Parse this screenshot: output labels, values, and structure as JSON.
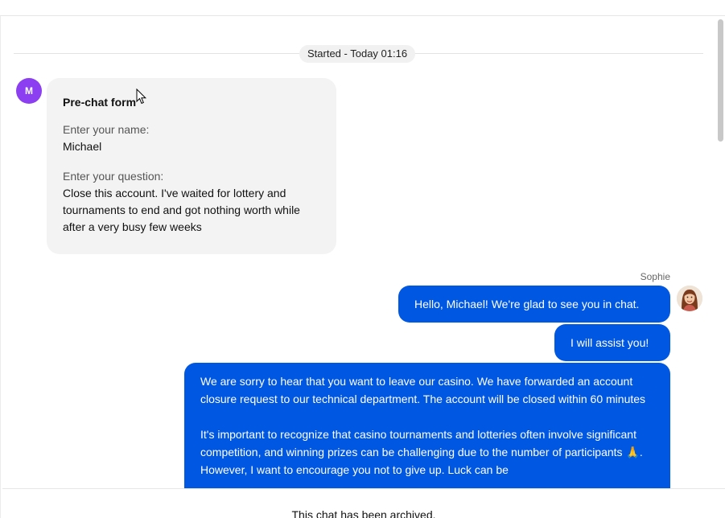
{
  "chat": {
    "started_label": "Started - Today 01:16",
    "customer_initial": "M",
    "prechat": {
      "title": "Pre-chat form",
      "name_label": "Enter your name:",
      "name_value": "Michael",
      "question_label": "Enter your question:",
      "question_value": "Close this account. I've waited for lottery and tournaments to end and got nothing worth while after a very busy few weeks"
    },
    "agent_name": "Sophie",
    "messages": [
      "Hello, Michael! We're glad to see you in chat.",
      "I will assist you!"
    ],
    "long_message": {
      "para1": "We are sorry to hear that you want to leave our casino. We have forwarded an account closure request to our technical department. The account will be closed within 60 minutes",
      "para2": "It's important to recognize that casino tournaments and lotteries often involve significant competition, and winning prizes can be challenging due to the number of participants 🙏. However, I want to encourage you not to give up. Luck can be"
    }
  },
  "footer": {
    "archived_text": "This chat has been archived."
  },
  "colors": {
    "agent_bubble": "#0057e2",
    "customer_avatar": "#8b3ff0",
    "prechat_bg": "#f3f3f3"
  }
}
